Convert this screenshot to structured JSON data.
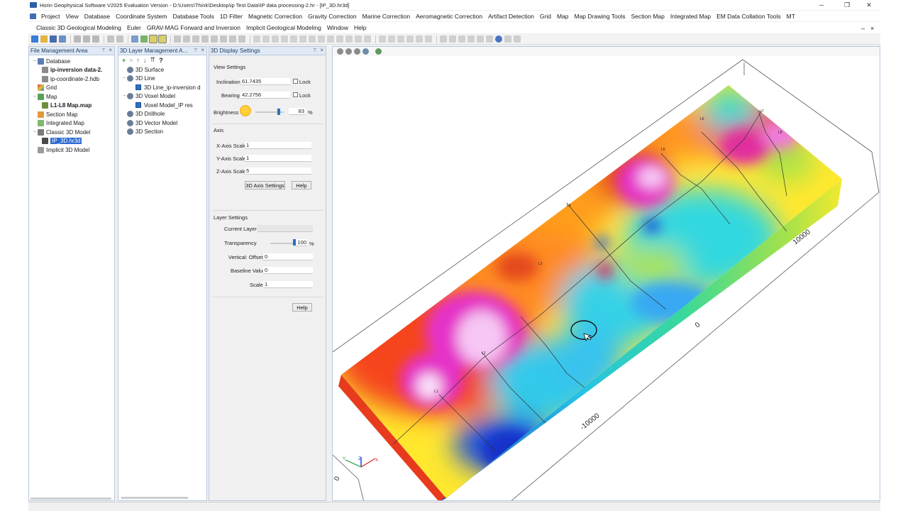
{
  "window": {
    "title": "Horin Geophysical Software V2025 Evaluation Version - D:\\Users\\Think\\Desktop\\ip Test Data\\IP data processing-2.hr - [IP_3D.hr3d]",
    "controls": {
      "minimize": "─",
      "maximize": "❐",
      "close": "✕"
    }
  },
  "menu": {
    "row1": [
      "Project",
      "View",
      "Database",
      "Coordinate System",
      "Database Tools",
      "1D Filter",
      "Magnetic Correction",
      "Gravity Correction",
      "Marine Correction",
      "Aeromagnetic Correction",
      "Artifact Detection",
      "Grid",
      "Map",
      "Map Drawing Tools",
      "Section Map",
      "Integrated Map",
      "EM Data Collation Tools",
      "MT"
    ],
    "row2": [
      "Classic 3D Geological Modeling",
      "Euler",
      "GRAV-MAG Forward and Inversion",
      "Implicit Geological Modeling",
      "Window",
      "Help"
    ],
    "mdi_controls": {
      "minimize": "–",
      "close": "×"
    }
  },
  "file_panel": {
    "title": "File Management Area",
    "items": [
      {
        "label": "Database",
        "level": 0,
        "expander": "−"
      },
      {
        "label": "ip-inversion data-2.",
        "level": 1,
        "bold": true
      },
      {
        "label": "ip-coordinate-2.hdb",
        "level": 1
      },
      {
        "label": "Grid",
        "level": 0
      },
      {
        "label": "Map",
        "level": 0,
        "expander": "−"
      },
      {
        "label": "L1-L8 Map.map",
        "level": 1,
        "bold": true
      },
      {
        "label": "Section Map",
        "level": 0
      },
      {
        "label": "Integrated Map",
        "level": 0
      },
      {
        "label": "Classic 3D Model",
        "level": 0,
        "expander": "−"
      },
      {
        "label": "IP_3D.hr3d",
        "level": 1,
        "selected": true
      },
      {
        "label": "Implicit 3D Model",
        "level": 0
      }
    ]
  },
  "layer_panel": {
    "title": "3D Layer Management A...",
    "toolbar": [
      "+",
      "×",
      "↑",
      "↓",
      "⇈",
      "?"
    ],
    "items": [
      {
        "label": "3D Surface",
        "level": 0
      },
      {
        "label": "3D Line",
        "level": 0,
        "expander": "−"
      },
      {
        "label": "3D Line_ip-inversion d",
        "level": 1,
        "checked": true
      },
      {
        "label": "3D Voxel Model",
        "level": 0,
        "expander": "−"
      },
      {
        "label": "Voxel Model_IP res",
        "level": 1,
        "checked": true
      },
      {
        "label": "3D Drillhole",
        "level": 0
      },
      {
        "label": "3D Vector Model",
        "level": 0
      },
      {
        "label": "3D Section",
        "level": 0
      }
    ]
  },
  "display_settings": {
    "title": "3D Display Settings",
    "view": {
      "group": "View Settings",
      "inclination_label": "Inclination",
      "inclination": "61.7435",
      "bearing_label": "Bearing",
      "bearing": "42.2756",
      "lock_label": "Lock",
      "brightness_label": "Brightness",
      "brightness": "83",
      "brightness_unit": "%",
      "brightness_level": 0.83
    },
    "axis": {
      "group": "Axis",
      "x_label": "X-Axis Scale",
      "x": "1",
      "y_label": "Y-Axis Scale",
      "y": "1",
      "z_label": "Z-Axis Scale",
      "z": "5",
      "settings_button": "3D Axis Settings",
      "help_button": "Help"
    },
    "layer": {
      "group": "Layer Settings",
      "current_label": "Current Layer",
      "current": "",
      "transparency_label": "Transparency",
      "transparency": "100",
      "transparency_unit": "%",
      "transparency_level": 1.0,
      "offset_label": "Vertical: Offset",
      "offset": "0",
      "baseline_label": "Baseline Value",
      "baseline": "0",
      "scale_label": "Scale",
      "scale": "1"
    },
    "help_button": "Help"
  },
  "view3d": {
    "axis_ticks": [
      "-10000",
      "0",
      "10000"
    ],
    "axis_gizmo": {
      "x": "X",
      "y": "Y",
      "z": "Z"
    },
    "side_tick": "0",
    "line_labels": [
      "L1",
      "L2",
      "L3",
      "L4",
      "L5",
      "L6",
      "L7",
      "L8"
    ]
  },
  "colors": {
    "panel_header": "#dfe9f5",
    "selection": "#2d6bd0",
    "accent": "#2a6fc9"
  }
}
